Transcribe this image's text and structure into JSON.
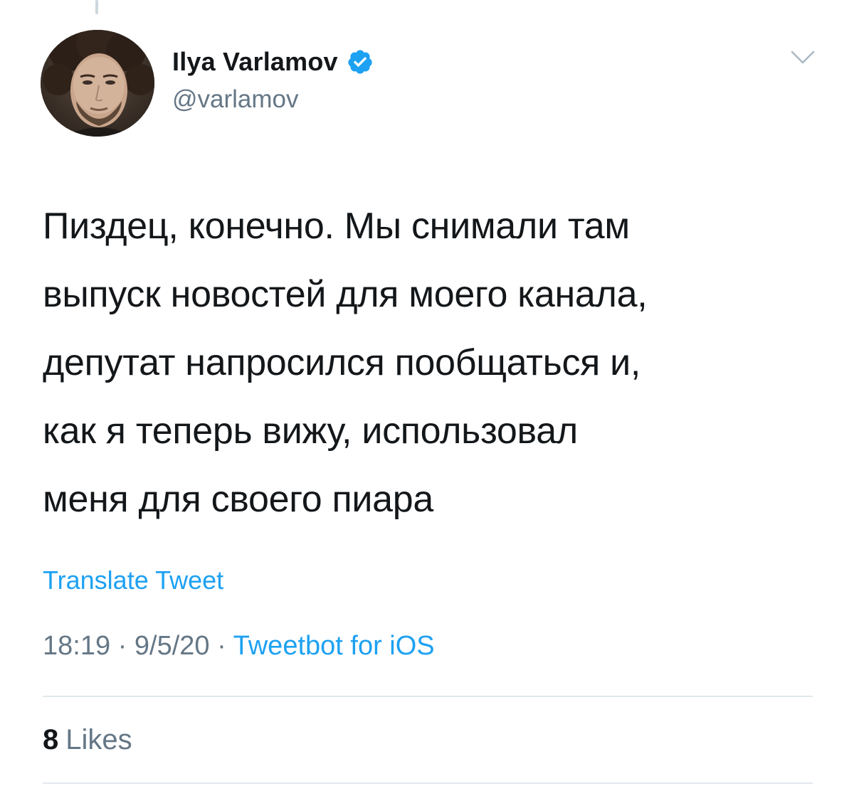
{
  "author": {
    "display_name": "Ilya Varlamov",
    "handle": "@varlamov",
    "verified": true
  },
  "tweet": {
    "text": "Пиздец, конечно. Мы снимали там\nвыпуск новостей для моего канала,\nдепутат напросился пообщаться и,\nкак я теперь вижу, использовал\nменя для своего пиара"
  },
  "translate_label": "Translate Tweet",
  "meta": {
    "time": "18:19",
    "separator_1": " · ",
    "date": "9/5/20",
    "separator_2": " · ",
    "source": "Tweetbot for iOS"
  },
  "likes": {
    "count": "8",
    "label": "Likes"
  },
  "icons": {
    "verified": "verified-badge-icon",
    "menu": "chevron-down-icon"
  },
  "colors": {
    "link": "#1da1f2",
    "secondary_text": "#657786",
    "divider": "#e1e8ed"
  }
}
